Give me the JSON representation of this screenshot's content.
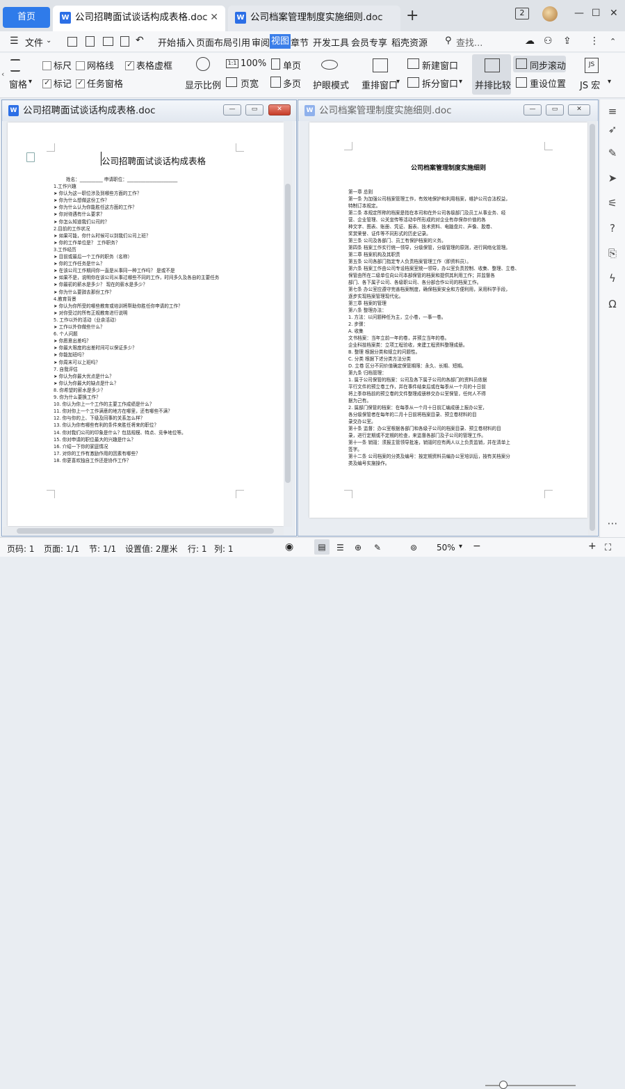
{
  "tabs": {
    "home": "首页",
    "doc1": "公司招聘面试谈话构成表格.doc",
    "doc2": "公司档案管理制度实施细则.doc",
    "word_icon": "W",
    "badge": "2"
  },
  "menu": {
    "file": "文件",
    "items": [
      "开始",
      "插入",
      "页面布局",
      "引用",
      "审阅",
      "视图",
      "章节",
      "开发工具",
      "会员专享",
      "稻壳资源"
    ],
    "search": "查找..."
  },
  "ribbon": {
    "pane_label": "窗格",
    "ruler": "标尺",
    "gridlines": "网格线",
    "table_gridlines": "表格虚框",
    "marks": "标记",
    "task_pane": "任务窗格",
    "show_ratio": "显示比例",
    "zoom100": "100%",
    "page_width": "页宽",
    "single_page": "单页",
    "multi_page": "多页",
    "eye_mode": "护眼模式",
    "arrange": "重排窗口",
    "new_window": "新建窗口",
    "split_window": "拆分窗口",
    "side_by_side": "并排比较",
    "sync_scroll": "同步滚动",
    "reset_pos": "重设位置",
    "js_macro": "JS 宏",
    "js_icon": "JS"
  },
  "left_doc": {
    "window_title": "公司招聘面试谈话构成表格.doc",
    "title": "公司招聘面试谈话构成表格",
    "fields": "姓名：__________          申请职位：______________________",
    "lines": [
      "1.工作兴趣",
      "➤   你认为这一职位涉及到哪些方面的工作？",
      "➤   你为什么想做这份工作？",
      "➤   你为什么认为你能胜任这方面的工作？",
      "➤   你对待遇有什么要求？",
      "➤   你怎么知道我们公司的？",
      "2.目前的工作状况",
      "➤   如果可能，你什么时候可以到我们公司上班？",
      "➤   你的工作单位是？   工作职务？",
      "3.工作经历",
      "➤   目前或最后一个工作的职务（名称）",
      "➤   你的工作任务是什么？",
      "➤   在该公司工作期间你一直是从事同一种工作吗？  是或不是",
      "➤   如果不是，说明你在该公司从事过哪些不同的工作，时间多久及各自的主要任务",
      "➤   你最初的薪水是多少？  现在的薪水是多少？",
      "➤   你为什么要辞去那份工作？",
      "4.教育背景",
      "➤   你认为你所受的哪些教育或培训将帮助你胜任你申请的工作？",
      "➤   对你受过的所有正规教育进行说明",
      "5. 工作以外的活动（业余活动）",
      "➤   工作以外你做些什么？",
      "6. 个人问题",
      "➤   你愿意出差吗？",
      "➤   你最大限度的出差时间可以保证多少？",
      "➤   你能加班吗？",
      "➤   你周末可以上班吗？",
      "7. 自我评估",
      "➤   你认为你最大优点是什么？",
      "➤   你认为你最大的缺点是什么？",
      "8. 你希望的薪水是多少？",
      "9. 你为什么要换工作？",
      "10. 你认为你上一个工作的主要工作成绩是什么？",
      "11. 你对你上一个工作满意的地方在哪里，还有哪些不满？",
      "12. 你与你的上、下级及同事的关系怎么样？",
      "13. 你认为你有哪些有利的条件来胜任将来的职位？",
      "14. 你对我们公司的印象是什么？包括规模、特点、竞争地位等。",
      "15. 你对申请的职位最大的兴趣是什么？",
      "16. 介绍一下你的家庭情况",
      "17. 对你的工作有激励作用的因素有哪些？",
      "18. 你更喜欢独自工作还是协作工作？"
    ]
  },
  "right_doc": {
    "window_title": "公司档案管理制度实施细则.doc",
    "title": "公司档案管理制度实施细则",
    "lines": [
      "第一章  总则",
      "第一条  为加强公司档案管理工作，有效地保护和利用档案，维护公司合法权益，",
      "           特制订本规定。",
      "第二条  本规定所称的档案是指在本司和在外公司各级部门及员工从事业务、经",
      "           营、企业管理、公关宣传等活动中所形成的对企业有存保存价值的各",
      "           种文字、图表、账册、凭证、报表、技术资料、电脑盘片、声像、胶卷、",
      "           奖赏荣誉、证件等不同形式的历史记录。",
      "第三条  公司及各部门、员工有保护档案的义务。",
      "第四条  档案工作实行统一领导，分级保管，分级管理的原则，进行网络化管理。",
      "第二章  档案机构及其职责",
      "第五条  公司各部门指定专人负责档案管理工作（即资料员）。",
      "第六条  档案工作由公司专设档案室统一领导，办公室负责控制、收集、整理、立卷、",
      "           保管由所在二级单位向公司本部保管的档案和提供其利用工作；并监督各",
      "           部门、各下属子公司、各级职公司、各分部合作公司的档案工作。",
      "第七条  办公室应遵守完善档案制度，确保档案安全和方便利用，采用科学手段，",
      "           逐步实现档案管理现代化。",
      "第三章  档案的管理",
      "第八条  整理办法：",
      "        1. 方法：以问题种任为主，立小卷，一事一卷。",
      "        2. 步骤：",
      "        A. 收集",
      "        文书档案：当年立前一年的卷，并预立当年的卷。",
      "        企业科技档案类：立项工程验收，来建工程资料整理成册。",
      "        B. 整理   根据分类和规立的问题性。",
      "        C. 分类   根据下述分类方法分类",
      "        D. 立卷   区分不同价值确定保管期限：永久、长期、短期。",
      "第九条  归档管理：",
      "        1. 属于公司保管的档案：公司及各下属子公司的各部门的资料员依据",
      "           平行文件的预立卷工作，并在事件结束后或在每季从一个月的十日前",
      "           将上季存档前的预立卷的文件整理成册移交办公室保管，任何人不得",
      "           据为己有。",
      "        2. 属部门保管的档案：在每季从一个月十日前汇编成册上报办公室，",
      "           各分级保管者在每年的二月十日前将档案目录、预立卷材料的目",
      "           录交办公室。",
      "第十条  监督：办公室根据各部门和各级子公司的档案目录、预立卷材料的目",
      "           录，进行定期或不定期的检查，来监督各部门及子公司的管理工作。",
      "第十一条  销毁：须报主管领导批准，销毁时应有两人以上负责监销，并在清单上",
      "           签字。",
      "第十二条  公司档案的分类及编号：按定期资料员编办公室培训后，按有关档案分",
      "           类及编号实施操作。"
    ]
  },
  "status": {
    "page": "页码: 1",
    "pages": "页面: 1/1",
    "section": "节: 1/1",
    "setting": "设置值: 2厘米",
    "row": "行: 1",
    "col": "列: 1",
    "zoom": "50%",
    "minus": "−",
    "plus": "+"
  }
}
